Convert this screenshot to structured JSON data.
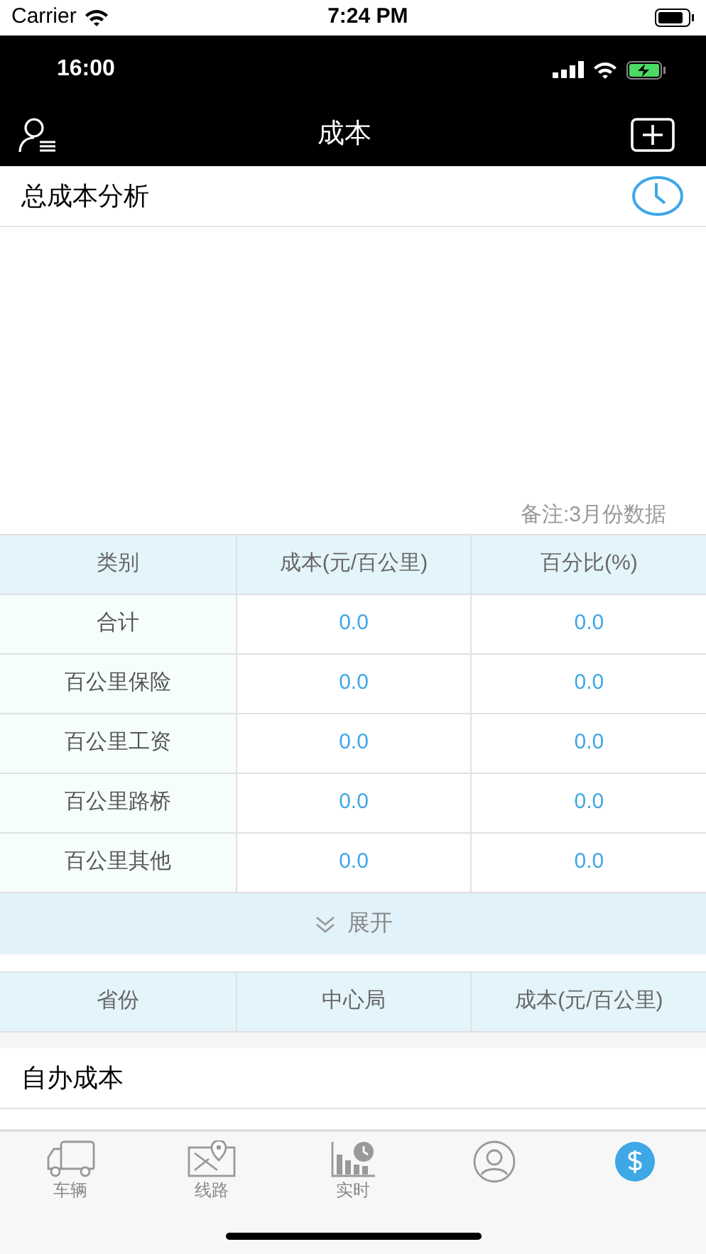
{
  "status_bar": {
    "carrier": "Carrier",
    "time": "7:24 PM"
  },
  "inner_status_bar": {
    "time": "16:00"
  },
  "nav_bar": {
    "title": "成本"
  },
  "section": {
    "title": "总成本分析"
  },
  "note": "备注:3月份数据",
  "table": {
    "columns": [
      "类别",
      "成本(元/百公里)",
      "百分比(%)"
    ],
    "rows": [
      [
        "合计",
        "0.0",
        "0.0"
      ],
      [
        "百公里保险",
        "0.0",
        "0.0"
      ],
      [
        "百公里工资",
        "0.0",
        "0.0"
      ],
      [
        "百公里路桥",
        "0.0",
        "0.0"
      ],
      [
        "百公里其他",
        "0.0",
        "0.0"
      ]
    ]
  },
  "expand_button": {
    "label": "展开"
  },
  "table_2": {
    "columns": [
      "省份",
      "中心局",
      "成本(元/百公里)"
    ]
  },
  "section_2": {
    "title": "自办成本"
  },
  "tab_bar": {
    "items": [
      {
        "kind": "truck",
        "label": "车辆",
        "selected": false
      },
      {
        "kind": "route",
        "label": "线路",
        "selected": false
      },
      {
        "kind": "realtime",
        "label": "实时",
        "selected": false
      },
      {
        "kind": "person",
        "selected": false
      },
      {
        "kind": "money",
        "selected": true
      }
    ]
  }
}
